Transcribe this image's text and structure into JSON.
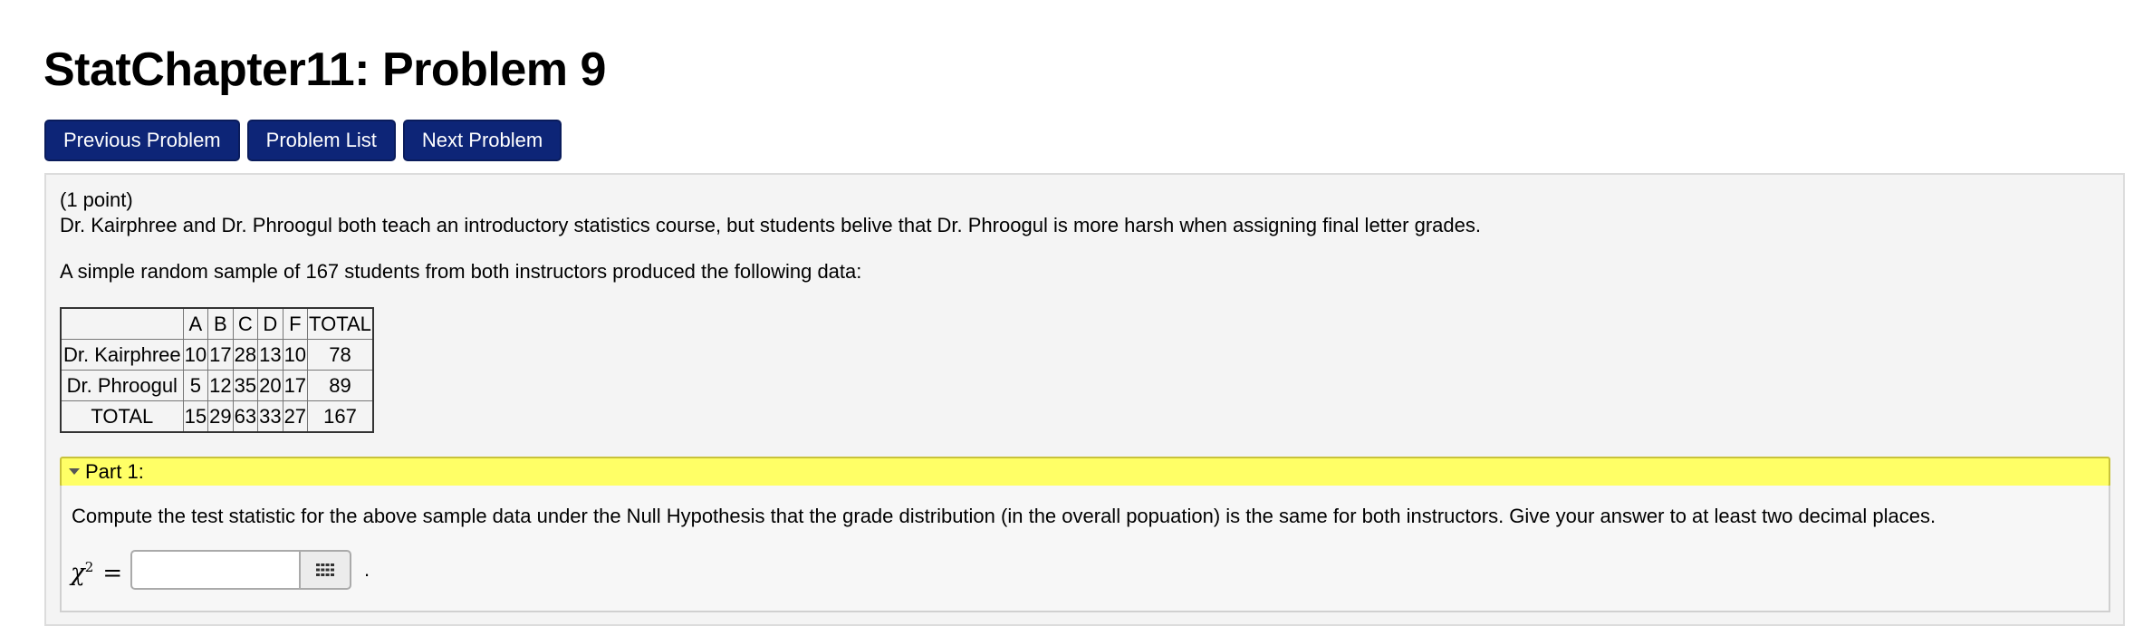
{
  "page": {
    "title": "StatChapter11: Problem 9"
  },
  "nav": {
    "previous_label": "Previous Problem",
    "list_label": "Problem List",
    "next_label": "Next Problem"
  },
  "problem": {
    "points": "(1 point)",
    "intro": "Dr. Kairphree and Dr. Phroogul both teach an introductory statistics course, but students belive that Dr. Phroogul is more harsh when assigning final letter grades.",
    "sample_text": "A simple random sample of 167 students from both instructors produced the following data:",
    "table": {
      "headers": [
        "",
        "A",
        "B",
        "C",
        "D",
        "F",
        "TOTAL"
      ],
      "rows": [
        [
          "Dr. Kairphree",
          "10",
          "17",
          "28",
          "13",
          "10",
          "78"
        ],
        [
          "Dr. Phroogul",
          "5",
          "12",
          "35",
          "20",
          "17",
          "89"
        ],
        [
          "TOTAL",
          "15",
          "29",
          "63",
          "33",
          "27",
          "167"
        ]
      ]
    }
  },
  "part1": {
    "header": "Part 1:",
    "question": "Compute the test statistic for the above sample data under the Null Hypothesis that the grade distribution (in the overall popuation) is the same for both instructors. Give your answer to at least two decimal places.",
    "symbol": "χ",
    "superscript": "2",
    "equals": "=",
    "answer_value": "",
    "trailing": "."
  },
  "icons": {
    "answer_tool": "keypad-icon",
    "collapse": "caret-down-icon"
  },
  "colors": {
    "button_bg": "#0d2577",
    "part_header_bg": "#ffff66",
    "panel_bg": "#f4f4f4"
  }
}
